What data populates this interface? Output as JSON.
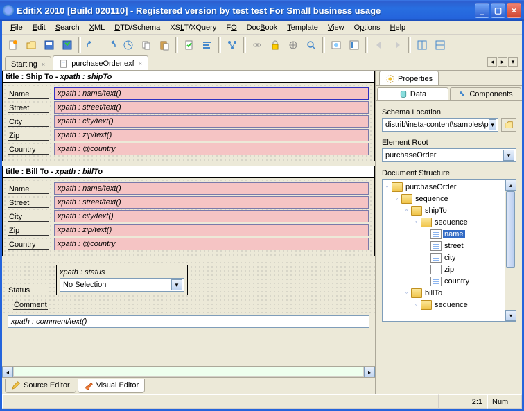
{
  "title": "EditiX 2010 [Build 020110] - Registered version by test test For Small business usage",
  "menu": [
    "File",
    "Edit",
    "Search",
    "XML",
    "DTD/Schema",
    "XSLT/XQuery",
    "FO",
    "DocBook",
    "Template",
    "View",
    "Options",
    "Help"
  ],
  "tabs": {
    "t0": "Starting",
    "t1": "purchaseOrder.exf"
  },
  "shipTo": {
    "title_a": "title : Ship To - ",
    "title_b": "xpath : shipTo",
    "rows": {
      "name": {
        "label": "Name",
        "value": "xpath : name/text()"
      },
      "street": {
        "label": "Street",
        "value": "xpath : street/text()"
      },
      "city": {
        "label": "City",
        "value": "xpath : city/text()"
      },
      "zip": {
        "label": "Zip",
        "value": "xpath : zip/text()"
      },
      "country": {
        "label": "Country",
        "value": "xpath : @country"
      }
    }
  },
  "billTo": {
    "title_a": "title : Bill To - ",
    "title_b": "xpath : billTo",
    "rows": {
      "name": {
        "label": "Name",
        "value": "xpath : name/text()"
      },
      "street": {
        "label": "Street",
        "value": "xpath : street/text()"
      },
      "city": {
        "label": "City",
        "value": "xpath : city/text()"
      },
      "zip": {
        "label": "Zip",
        "value": "xpath : zip/text()"
      },
      "country": {
        "label": "Country",
        "value": "xpath : @country"
      }
    }
  },
  "status": {
    "label": "Status",
    "hint": "xpath : status",
    "value": "No Selection"
  },
  "comment": {
    "label": "Comment",
    "value": "xpath : comment/text()"
  },
  "bottomTabs": {
    "t0": "Source Editor",
    "t1": "Visual Editor"
  },
  "props": {
    "tab": "Properties",
    "sub0": "Data",
    "sub1": "Components",
    "schemaLabel": "Schema Location",
    "schemaValue": "distrib\\insta-content\\samples\\purchaseOrder.xsd",
    "rootLabel": "Element Root",
    "rootValue": "purchaseOrder",
    "structLabel": "Document Structure",
    "tree": {
      "n0": "purchaseOrder",
      "n1": "sequence",
      "n2": "shipTo",
      "n3": "sequence",
      "n4": "name",
      "n5": "street",
      "n6": "city",
      "n7": "zip",
      "n8": "country",
      "n9": "billTo",
      "n10": "sequence"
    }
  },
  "statusbar": {
    "pos": "2:1",
    "num": "Num"
  }
}
